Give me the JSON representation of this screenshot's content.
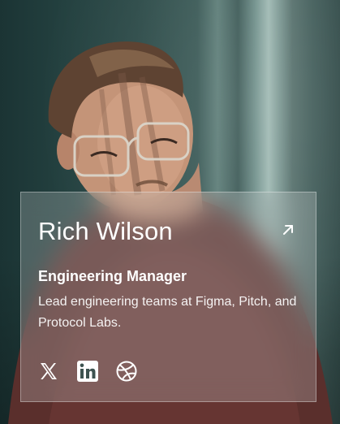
{
  "profile": {
    "name": "Rich Wilson",
    "role": "Engineering Manager",
    "bio": "Lead engineering teams at Figma, Pitch, and Protocol Labs."
  },
  "icons": {
    "external_link": "arrow-up-right-icon",
    "social": [
      "x-icon",
      "linkedin-icon",
      "dribbble-icon"
    ]
  },
  "colors": {
    "card_tint": "#c8cdcd",
    "text": "#ffffff",
    "background": "#23403f"
  }
}
